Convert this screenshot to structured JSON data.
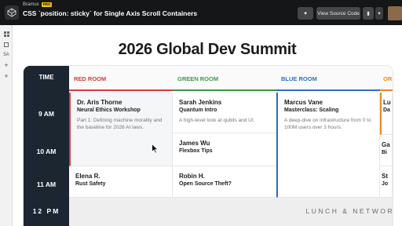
{
  "header": {
    "brand": "Bramus",
    "badge": "PRO",
    "pen_title": "CSS `position: sticky` for Single Axis Scroll Containers",
    "view_source_label": "View Source Code",
    "heart_glyph": "♥",
    "bookmark_glyph": "▮",
    "caret_glyph": "▾"
  },
  "rail": {
    "items": [
      {
        "icon": "grid-icon"
      },
      {
        "icon": "tiles-icon"
      },
      {
        "icon": "label",
        "text": "5A"
      },
      {
        "icon": "plus-icon",
        "text": "+"
      },
      {
        "icon": "add-icon",
        "text": "+"
      }
    ]
  },
  "page": {
    "title": "2026 Global Dev Summit"
  },
  "schedule": {
    "time_header": "TIME",
    "times": [
      "9 AM",
      "10 AM",
      "11 AM",
      "12 PM"
    ],
    "rooms": [
      {
        "name": "RED ROOM",
        "color": "#d93a3a"
      },
      {
        "name": "GREEN ROOM",
        "color": "#3a9a4a"
      },
      {
        "name": "BLUE ROOM",
        "color": "#2f6fc4"
      },
      {
        "name": "OR",
        "color": "#e38a24"
      }
    ],
    "sessions": [
      {
        "speaker": "Dr. Aris Thorne",
        "title": "Neural Ethics Workshop",
        "description": "Part 1: Defining machine morality and the baseline for 2026 AI laws."
      },
      {
        "speaker": "Sarah Jenkins",
        "title": "Quantum Intro",
        "description": "A high-level look at qubits and UI."
      },
      {
        "speaker": "Marcus Vane",
        "title": "Masterclass: Scaling",
        "description": "A deep-dive on infrastructure from 0 to 100M users over 3 hours."
      },
      {
        "speaker": "Lu",
        "title": "Da",
        "description": ""
      },
      {
        "speaker": "James Wu",
        "title": "Flexbox Tips",
        "description": ""
      },
      {
        "speaker": "Ga",
        "title": "Bi",
        "description": ""
      },
      {
        "speaker": "Elena R.",
        "title": "Rust Safety",
        "description": ""
      },
      {
        "speaker": "Robin H.",
        "title": "Open Source Theft?",
        "description": ""
      },
      {
        "speaker": "St",
        "title": "Jo",
        "description": ""
      }
    ],
    "lunch_label": "LUNCH & NETWOR"
  }
}
